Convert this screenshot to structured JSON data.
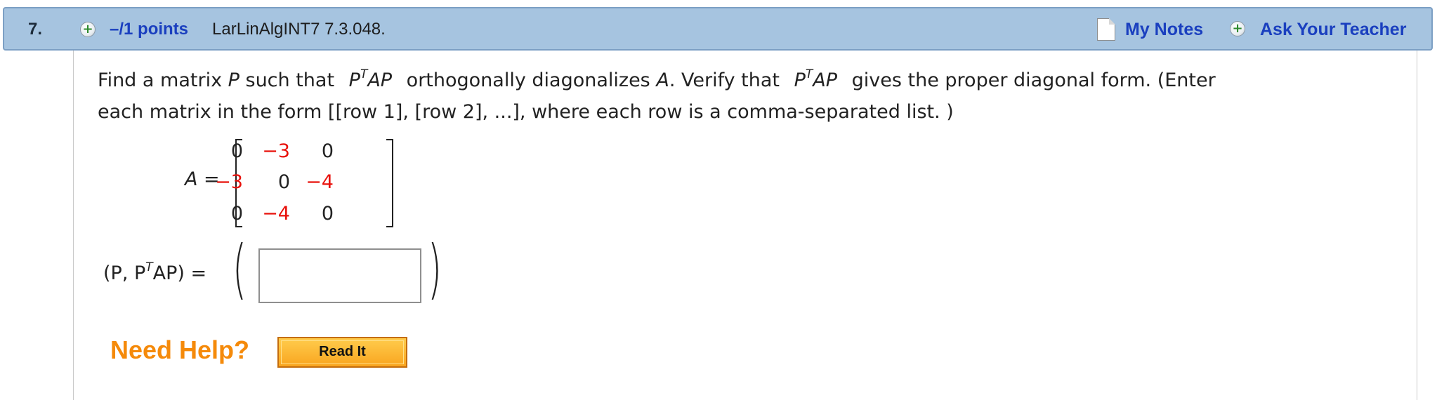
{
  "header": {
    "question_number": "7.",
    "points": "–/1 points",
    "source": "LarLinAlgINT7 7.3.048.",
    "my_notes": "My Notes",
    "ask_teacher": "Ask Your Teacher"
  },
  "question": {
    "part1": "Find a matrix ",
    "var_P": "P",
    "part2": " such that ",
    "expr1_P": "P",
    "expr1_T": "T",
    "expr1_AP": "AP",
    "part3": " orthogonally diagonalizes ",
    "var_A": "A",
    "part4": ". Verify that ",
    "expr2_P": "P",
    "expr2_T": "T",
    "expr2_AP": "AP",
    "part5": " gives the proper diagonal form. (Enter",
    "line2": "each matrix in the form [[row 1], [row 2], ...], where each row is a comma-separated list. )"
  },
  "matrix": {
    "label": "A =",
    "rows": [
      [
        "0",
        "−3",
        "0"
      ],
      [
        "−3",
        "0",
        "−4"
      ],
      [
        "0",
        "−4",
        "0"
      ]
    ],
    "negative_color": "#e8110b"
  },
  "answer": {
    "label_open": "(P, P",
    "label_sup": "T",
    "label_close": "AP) =",
    "value": ""
  },
  "help": {
    "need_help": "Need Help?",
    "read_it": "Read It"
  },
  "colors": {
    "header_bg": "#a6c4e0",
    "link": "#1a3fbf",
    "need_help": "#f58a0a",
    "button": "#f9a51f"
  }
}
